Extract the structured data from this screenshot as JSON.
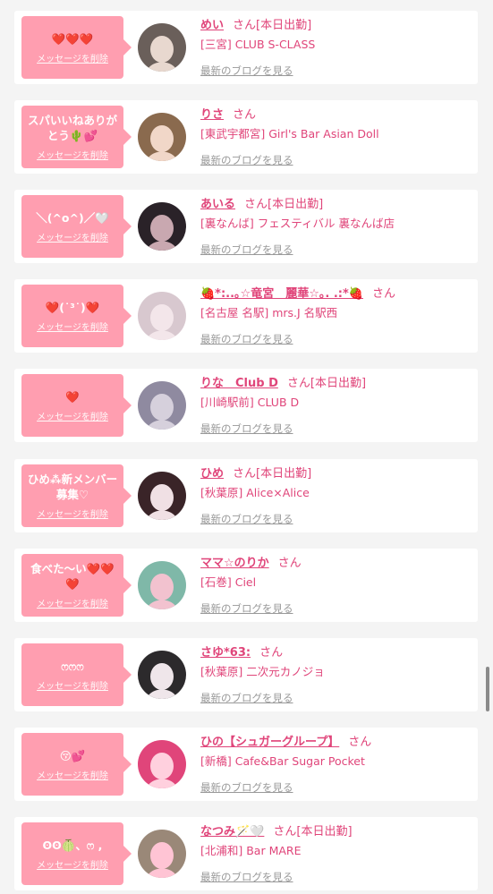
{
  "delete_label": "メッセージを削除",
  "blog_label": "最新のブログを見る",
  "colors": {
    "bubble": "#ff9eb0",
    "accent": "#e0457a",
    "blog_link": "#999999",
    "background": "#f4f4f4"
  },
  "items": [
    {
      "message": "❤️❤️❤️",
      "name": "めい",
      "san": "さん",
      "working": "[本日出勤]",
      "shop": "[三宮] CLUB S-CLASS",
      "avatar_colors": [
        "#6a5f5a",
        "#e8d8cf"
      ]
    },
    {
      "message": "スパいいねありがとう🌵💕",
      "name": "りさ",
      "san": "さん",
      "working": "",
      "shop": "[東武宇都宮] Girl's Bar Asian Doll",
      "avatar_colors": [
        "#8a6a4e",
        "#f1d7c8"
      ]
    },
    {
      "message": "＼(^o^)／🤍",
      "name": "あいる",
      "san": "さん",
      "working": "[本日出勤]",
      "shop": "[裏なんば] フェスティバル 裏なんば店",
      "avatar_colors": [
        "#2a2228",
        "#c9a8b0"
      ]
    },
    {
      "message": "❤️(˙³˙)❤️",
      "name": "🍓*:..｡☆竜宮　麗華☆｡. .:*🍓",
      "san": "さん",
      "working": "",
      "shop": "[名古屋 名駅] mrs.J 名駅西",
      "avatar_colors": [
        "#d8c8cf",
        "#f3e6ea"
      ]
    },
    {
      "message": "❤️",
      "name": "りな　Club D",
      "san": "さん",
      "working": "[本日出勤]",
      "shop": "[川崎駅前] CLUB D",
      "avatar_colors": [
        "#8f8aa0",
        "#d6d0dc"
      ]
    },
    {
      "message": "ひめ⁂新メンバー募集♡",
      "name": "ひめ",
      "san": "さん",
      "working": "[本日出勤]",
      "shop": "[秋葉原] Alice×Alice",
      "avatar_colors": [
        "#3a2428",
        "#f0e0e4"
      ]
    },
    {
      "message": "食べた〜い❤️❤️❤️",
      "name": "ママ☆のりか",
      "san": "さん",
      "working": "",
      "shop": "[石巻] Ciel",
      "avatar_colors": [
        "#7fb8a8",
        "#f2c2cf"
      ]
    },
    {
      "message": "ෆෆෆ",
      "name": "さゆ*63:",
      "san": "さん",
      "working": "",
      "shop": "[秋葉原] 二次元カノジョ",
      "avatar_colors": [
        "#2c2a2c",
        "#efe6ea"
      ]
    },
    {
      "message": "😚💕",
      "name": "ひの【シュガーグループ】",
      "san": "さん",
      "working": "",
      "shop": "[新橋] Cafe&Bar Sugar Pocket",
      "avatar_colors": [
        "#e0457a",
        "#ffd0de"
      ]
    },
    {
      "message": "ʘʘ🍈、ෆ ,",
      "name": "なつみ🪄🤍",
      "san": "さん",
      "working": "[本日出勤]",
      "shop": "[北浦和] Bar MARE",
      "avatar_colors": [
        "#9a8878",
        "#ffc4d4"
      ]
    }
  ]
}
